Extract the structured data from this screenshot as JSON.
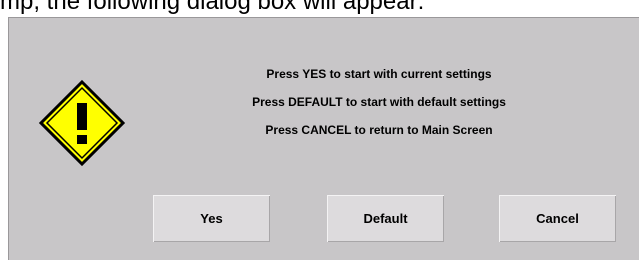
{
  "caption": "mp, the following dialog box will appear:",
  "dialog": {
    "icon": "warning-icon",
    "messages": [
      "Press YES to start with current settings",
      "Press DEFAULT to start with default settings",
      "Press CANCEL to return to Main Screen"
    ],
    "buttons": {
      "yes": "Yes",
      "default": "Default",
      "cancel": "Cancel"
    },
    "colors": {
      "background": "#c8c6c8",
      "button_face": "#dddbdd",
      "warning_fill": "#ffff00"
    }
  }
}
